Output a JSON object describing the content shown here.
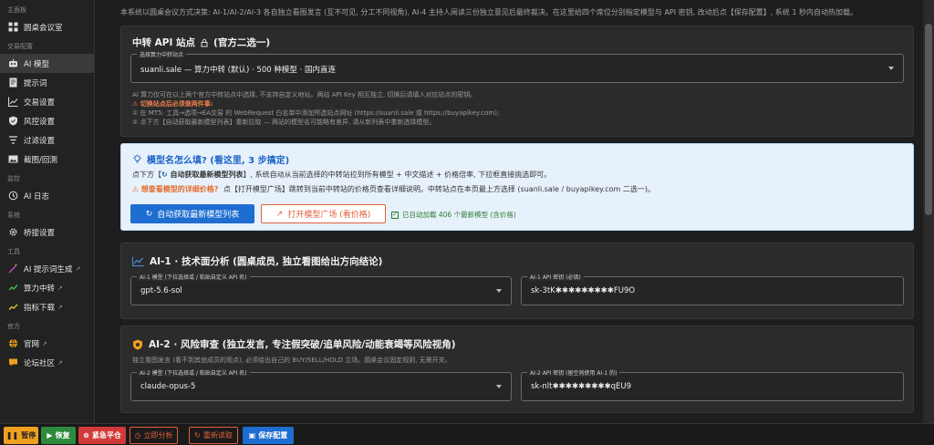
{
  "sidebar": {
    "groups": [
      {
        "label": "主面板",
        "items": [
          {
            "label": "圆桌会议室",
            "icon": "grid-icon"
          }
        ]
      },
      {
        "label": "交易配置",
        "items": [
          {
            "label": "AI 模型",
            "icon": "robot-icon",
            "active": true
          },
          {
            "label": "提示词",
            "icon": "document-icon"
          },
          {
            "label": "交易设置",
            "icon": "chart-line-icon"
          },
          {
            "label": "风控设置",
            "icon": "shield-icon"
          },
          {
            "label": "过滤设置",
            "icon": "filter-icon"
          },
          {
            "label": "截图/回测",
            "icon": "image-icon"
          }
        ]
      },
      {
        "label": "监控",
        "items": [
          {
            "label": "AI 日志",
            "icon": "history-icon"
          }
        ]
      },
      {
        "label": "系统",
        "items": [
          {
            "label": "桥接设置",
            "icon": "gear-icon"
          }
        ]
      },
      {
        "label": "工具",
        "items": [
          {
            "label": "AI 提示词生成",
            "icon": "wand-icon",
            "ext": true
          },
          {
            "label": "算力中转",
            "icon": "relay-icon",
            "ext": true
          },
          {
            "label": "指标下载",
            "icon": "trend-icon",
            "ext": true
          }
        ]
      },
      {
        "label": "官方",
        "items": [
          {
            "label": "官网",
            "icon": "globe-icon",
            "ext": true
          },
          {
            "label": "论坛社区",
            "icon": "chat-icon",
            "ext": true
          }
        ]
      }
    ]
  },
  "intro_text": "本系统以圆桌会议方式决策: AI-1/AI-2/AI-3 各自独立看图发言 (互不可见, 分工不同视角), AI-4 主持人阅读三份独立意见后最终裁决。在这里给四个席位分别指定模型与 API 密钥, 改动后点【保存配置】, 系统 1 秒内自动热加载。",
  "relay": {
    "title": "中转 API 站点",
    "title_suffix": "(官方二选一)",
    "field_label": "选择算力中转站点",
    "field_value": "suanli.sale — 算力中转 (默认) · 500 种模型 · 国内直连",
    "note1": "AI 算力仅可在以上两个官方中转站点中选择, 不支持自定义地址。两站 API Key 相互独立, 切换后请填入对应站点的密钥。",
    "warn": "⚠ 切换站点后必须做两件事:",
    "step1": "① 在 MT5: 工具→选项→EA交易 的 WebRequest 白名单中添加所选站点网址 (https://suanli.sale 或 https://buyapikey.com);",
    "step2": "② 点下方【自动获取最新模型列表】重新拉取 — 两站的模型名可能略有差异, 请从新列表中重新选择模型。"
  },
  "info": {
    "title": "模型名怎么填? (看这里, 3 步搞定)",
    "line1_pre": "点下方【",
    "line1_bold": "自动获取最新模型列表",
    "line1_post": "】, 系统自动从当前选择的中转站拉到所有模型 + 中文描述 + 价格倍率, 下拉框直接挑选即可。",
    "line2_warn": "想查看模型的详细价格?",
    "line2_post": "点【打开模型广场】跳转到当前中转站的价格页查看详细说明。中转站点在本页最上方选择 (suanli.sale / buyapikey.com 二选一)。",
    "btn_fetch": "自动获取最新模型列表",
    "btn_open": "打开模型广场 (看价格)",
    "loaded": "已自动加载 406 个最新模型 (含价格)"
  },
  "ai1": {
    "title": "AI-1 · 技术面分析 (圆桌成员, 独立看图给出方向结论)",
    "model_label": "AI-1 模型 (下拉选择或 / 粘贴自定义 API 名)",
    "model_value": "gpt-5.6-sol",
    "key_label": "AI-1 API 密钥 (必填)",
    "key_value": "sk-3tK✱✱✱✱✱✱✱✱✱FU9O"
  },
  "ai2": {
    "title": "AI-2 · 风险审查 (独立发言, 专注假突破/追单风险/动能衰竭等风险视角)",
    "desc": "独立看图发言 (看不到其他成员的观点), 必须给出自己的 BUY/SELL/HOLD 立场。圆桌会议固定规则, 无需开关。",
    "model_label": "AI-2 模型 (下拉选择或 / 粘贴自定义 API 名)",
    "model_value": "claude-opus-5",
    "key_label": "AI-2 API 密钥 (留空则使用 AI-1 的)",
    "key_value": "sk-nlt✱✱✱✱✱✱✱✱✱qEU9"
  },
  "toolbar": {
    "pause": "暂停",
    "resume": "恢复",
    "emergency": "紧急平仓",
    "analyze": "立即分析",
    "reload": "重新读取",
    "save": "保存配置"
  },
  "colors": {
    "primary": "#1e6dd0",
    "warn": "#e0603b",
    "ai2_badge": "#f0a020",
    "ai1_icon": "#4a8fe0"
  }
}
